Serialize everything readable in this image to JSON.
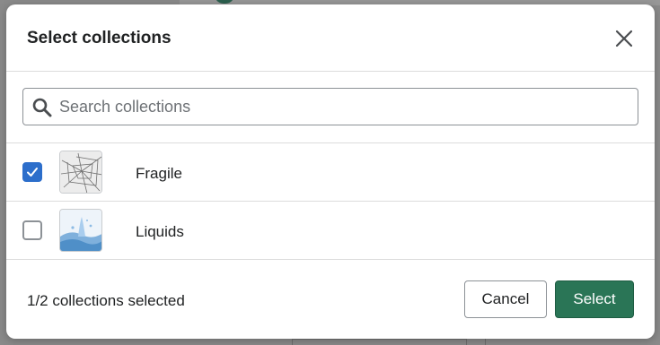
{
  "modal": {
    "title": "Select collections",
    "close_icon": "close-icon"
  },
  "search": {
    "placeholder": "Search collections",
    "value": "",
    "icon": "search-icon"
  },
  "collections": [
    {
      "label": "Fragile",
      "checked": true,
      "thumbnail": "cracked-glass-image"
    },
    {
      "label": "Liquids",
      "checked": false,
      "thumbnail": "water-splash-image"
    }
  ],
  "footer": {
    "status": "1/2 collections selected",
    "cancel_label": "Cancel",
    "select_label": "Select"
  },
  "colors": {
    "primary": "#2a7556",
    "checkbox_checked": "#2c6ecb",
    "backdrop": "#8a8a8a"
  }
}
